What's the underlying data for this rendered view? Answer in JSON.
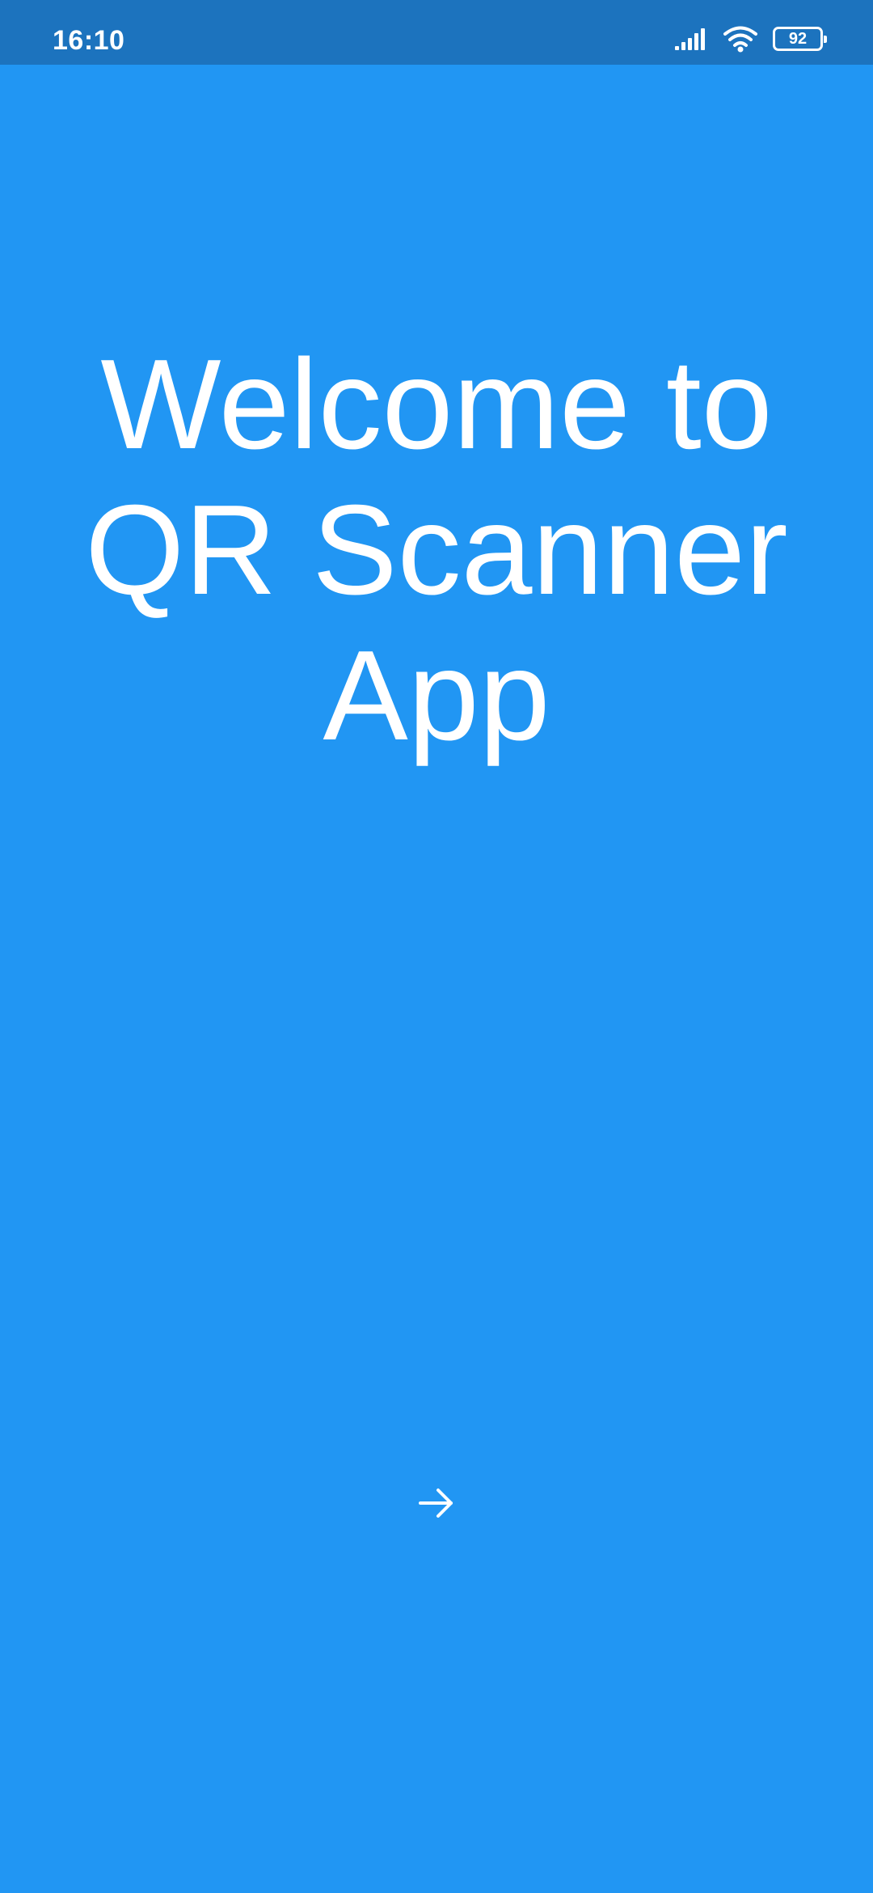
{
  "status_bar": {
    "time": "16:10",
    "battery": "92",
    "icons": [
      "signal-icon",
      "wifi-icon",
      "battery-icon"
    ]
  },
  "welcome": {
    "title": "Welcome to QR Scanner App"
  },
  "navigation": {
    "next_icon": "arrow-right-icon"
  },
  "colors": {
    "background": "#2196F3",
    "status_bar": "#1C73BE",
    "text": "#FFFFFF"
  }
}
